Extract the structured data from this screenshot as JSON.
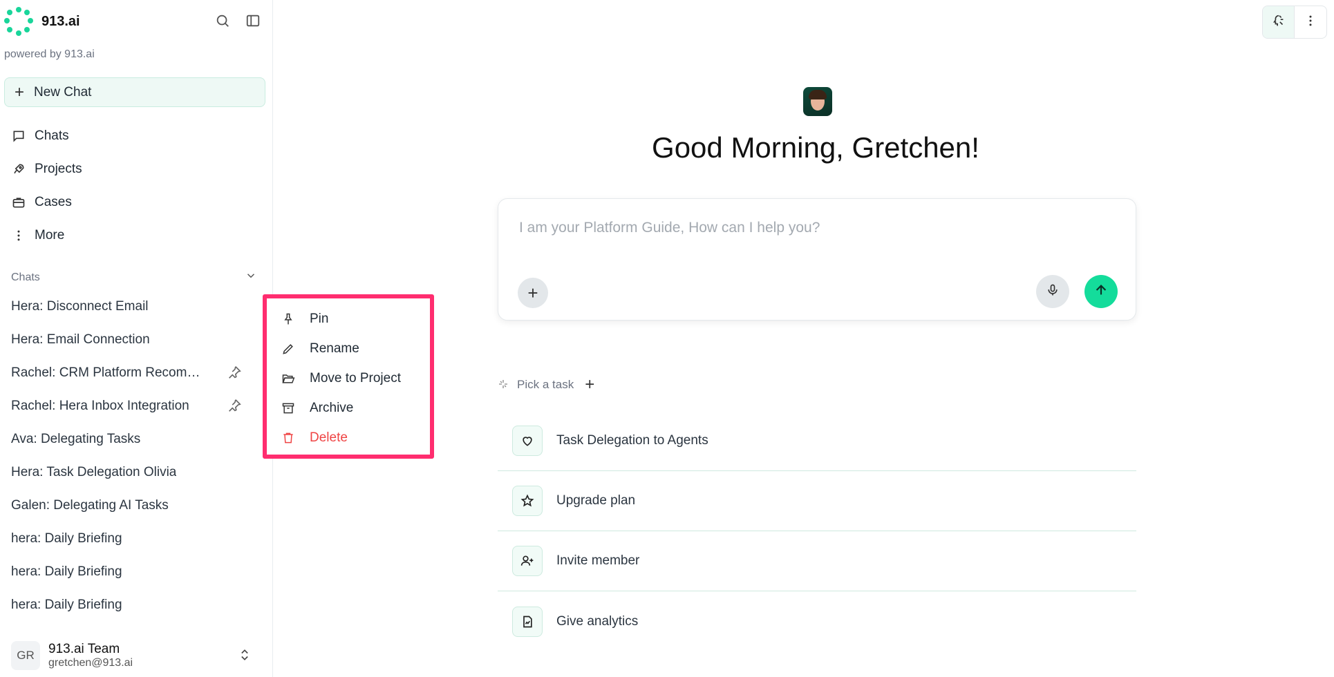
{
  "brand": {
    "name": "913.ai",
    "powered_by": "powered by 913.ai"
  },
  "sidebar": {
    "new_chat": "New Chat",
    "nav": [
      {
        "label": "Chats",
        "icon": "message-square-icon"
      },
      {
        "label": "Projects",
        "icon": "rocket-icon"
      },
      {
        "label": "Cases",
        "icon": "briefcase-icon"
      },
      {
        "label": "More",
        "icon": "more-vertical-icon"
      }
    ],
    "chats_header": "Chats",
    "chats": [
      {
        "title": "Hera: Disconnect Email",
        "pinned": false
      },
      {
        "title": "Hera: Email Connection",
        "pinned": false
      },
      {
        "title": "Rachel: CRM Platform Recomm...",
        "pinned": true
      },
      {
        "title": "Rachel: Hera Inbox Integration",
        "pinned": true
      },
      {
        "title": "Ava: Delegating Tasks",
        "pinned": false
      },
      {
        "title": "Hera: Task Delegation Olivia",
        "pinned": false
      },
      {
        "title": "Galen: Delegating AI Tasks",
        "pinned": false
      },
      {
        "title": "hera: Daily Briefing",
        "pinned": false
      },
      {
        "title": "hera: Daily Briefing",
        "pinned": false
      },
      {
        "title": "hera: Daily Briefing",
        "pinned": false
      }
    ],
    "user": {
      "initials": "GR",
      "name": "913.ai Team",
      "email": "gretchen@913.ai"
    }
  },
  "context_menu": {
    "pin": "Pin",
    "rename": "Rename",
    "move": "Move to Project",
    "archive": "Archive",
    "delete": "Delete"
  },
  "main": {
    "greeting": "Good Morning, Gretchen!",
    "composer": {
      "placeholder": "I am your Platform Guide, How can I help you?"
    },
    "pick_task": "Pick a task",
    "tasks": [
      {
        "label": "Task Delegation to Agents",
        "icon": "heart-icon"
      },
      {
        "label": "Upgrade plan",
        "icon": "star-icon"
      },
      {
        "label": "Invite member",
        "icon": "user-plus-icon"
      },
      {
        "label": "Give analytics",
        "icon": "file-chart-icon"
      }
    ]
  },
  "colors": {
    "accent": "#14dc9b",
    "highlight": "#ff2d6f",
    "danger": "#ef4444"
  }
}
